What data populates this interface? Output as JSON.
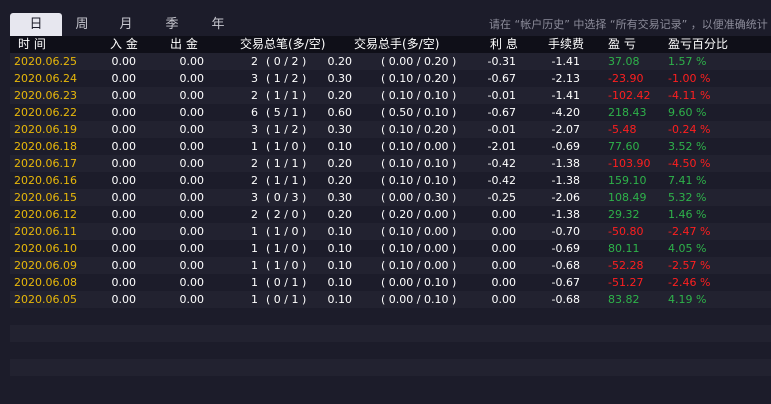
{
  "tabs": [
    {
      "label": "日",
      "active": true
    },
    {
      "label": "周",
      "active": false
    },
    {
      "label": "月",
      "active": false
    },
    {
      "label": "季",
      "active": false
    },
    {
      "label": "年",
      "active": false
    }
  ],
  "tip": "请在 “帐户历史” 中选择 “所有交易记录” ，以便准确统计",
  "columns": {
    "date": "时 间",
    "deposit": "入 金",
    "withdraw": "出 金",
    "trades": "交易总笔(多/空)",
    "lots": "交易总手(多/空)",
    "interest": "利 息",
    "fee": "手续费",
    "pnl": "盈 亏",
    "pnl_pct": "盈亏百分比"
  },
  "rows": [
    {
      "date": "2020.06.25",
      "deposit": "0.00",
      "withdraw": "0.00",
      "trades": "2",
      "trades_ls": "( 0 / 2 )",
      "lots": "0.20",
      "lots_ls": "( 0.00 / 0.20 )",
      "interest": "-0.31",
      "fee": "-1.41",
      "pnl": "37.08",
      "pnl_pct": "1.57 %",
      "sign": "pos"
    },
    {
      "date": "2020.06.24",
      "deposit": "0.00",
      "withdraw": "0.00",
      "trades": "3",
      "trades_ls": "( 1 / 2 )",
      "lots": "0.30",
      "lots_ls": "( 0.10 / 0.20 )",
      "interest": "-0.67",
      "fee": "-2.13",
      "pnl": "-23.90",
      "pnl_pct": "-1.00 %",
      "sign": "neg"
    },
    {
      "date": "2020.06.23",
      "deposit": "0.00",
      "withdraw": "0.00",
      "trades": "2",
      "trades_ls": "( 1 / 1 )",
      "lots": "0.20",
      "lots_ls": "( 0.10 / 0.10 )",
      "interest": "-0.01",
      "fee": "-1.41",
      "pnl": "-102.42",
      "pnl_pct": "-4.11 %",
      "sign": "neg"
    },
    {
      "date": "2020.06.22",
      "deposit": "0.00",
      "withdraw": "0.00",
      "trades": "6",
      "trades_ls": "( 5 / 1 )",
      "lots": "0.60",
      "lots_ls": "( 0.50 / 0.10 )",
      "interest": "-0.67",
      "fee": "-4.20",
      "pnl": "218.43",
      "pnl_pct": "9.60 %",
      "sign": "pos"
    },
    {
      "date": "2020.06.19",
      "deposit": "0.00",
      "withdraw": "0.00",
      "trades": "3",
      "trades_ls": "( 1 / 2 )",
      "lots": "0.30",
      "lots_ls": "( 0.10 / 0.20 )",
      "interest": "-0.01",
      "fee": "-2.07",
      "pnl": "-5.48",
      "pnl_pct": "-0.24 %",
      "sign": "neg"
    },
    {
      "date": "2020.06.18",
      "deposit": "0.00",
      "withdraw": "0.00",
      "trades": "1",
      "trades_ls": "( 1 / 0 )",
      "lots": "0.10",
      "lots_ls": "( 0.10 / 0.00 )",
      "interest": "-2.01",
      "fee": "-0.69",
      "pnl": "77.60",
      "pnl_pct": "3.52 %",
      "sign": "pos"
    },
    {
      "date": "2020.06.17",
      "deposit": "0.00",
      "withdraw": "0.00",
      "trades": "2",
      "trades_ls": "( 1 / 1 )",
      "lots": "0.20",
      "lots_ls": "( 0.10 / 0.10 )",
      "interest": "-0.42",
      "fee": "-1.38",
      "pnl": "-103.90",
      "pnl_pct": "-4.50 %",
      "sign": "neg"
    },
    {
      "date": "2020.06.16",
      "deposit": "0.00",
      "withdraw": "0.00",
      "trades": "2",
      "trades_ls": "( 1 / 1 )",
      "lots": "0.20",
      "lots_ls": "( 0.10 / 0.10 )",
      "interest": "-0.42",
      "fee": "-1.38",
      "pnl": "159.10",
      "pnl_pct": "7.41 %",
      "sign": "pos"
    },
    {
      "date": "2020.06.15",
      "deposit": "0.00",
      "withdraw": "0.00",
      "trades": "3",
      "trades_ls": "( 0 / 3 )",
      "lots": "0.30",
      "lots_ls": "( 0.00 / 0.30 )",
      "interest": "-0.25",
      "fee": "-2.06",
      "pnl": "108.49",
      "pnl_pct": "5.32 %",
      "sign": "pos"
    },
    {
      "date": "2020.06.12",
      "deposit": "0.00",
      "withdraw": "0.00",
      "trades": "2",
      "trades_ls": "( 2 / 0 )",
      "lots": "0.20",
      "lots_ls": "( 0.20 / 0.00 )",
      "interest": "0.00",
      "fee": "-1.38",
      "pnl": "29.32",
      "pnl_pct": "1.46 %",
      "sign": "pos"
    },
    {
      "date": "2020.06.11",
      "deposit": "0.00",
      "withdraw": "0.00",
      "trades": "1",
      "trades_ls": "( 1 / 0 )",
      "lots": "0.10",
      "lots_ls": "( 0.10 / 0.00 )",
      "interest": "0.00",
      "fee": "-0.70",
      "pnl": "-50.80",
      "pnl_pct": "-2.47 %",
      "sign": "neg"
    },
    {
      "date": "2020.06.10",
      "deposit": "0.00",
      "withdraw": "0.00",
      "trades": "1",
      "trades_ls": "( 1 / 0 )",
      "lots": "0.10",
      "lots_ls": "( 0.10 / 0.00 )",
      "interest": "0.00",
      "fee": "-0.69",
      "pnl": "80.11",
      "pnl_pct": "4.05 %",
      "sign": "pos"
    },
    {
      "date": "2020.06.09",
      "deposit": "0.00",
      "withdraw": "0.00",
      "trades": "1",
      "trades_ls": "( 1 / 0 )",
      "lots": "0.10",
      "lots_ls": "( 0.10 / 0.00 )",
      "interest": "0.00",
      "fee": "-0.68",
      "pnl": "-52.28",
      "pnl_pct": "-2.57 %",
      "sign": "neg"
    },
    {
      "date": "2020.06.08",
      "deposit": "0.00",
      "withdraw": "0.00",
      "trades": "1",
      "trades_ls": "( 0 / 1 )",
      "lots": "0.10",
      "lots_ls": "( 0.00 / 0.10 )",
      "interest": "0.00",
      "fee": "-0.67",
      "pnl": "-51.27",
      "pnl_pct": "-2.46 %",
      "sign": "neg"
    },
    {
      "date": "2020.06.05",
      "deposit": "0.00",
      "withdraw": "0.00",
      "trades": "1",
      "trades_ls": "( 0 / 1 )",
      "lots": "0.10",
      "lots_ls": "( 0.00 / 0.10 )",
      "interest": "0.00",
      "fee": "-0.68",
      "pnl": "83.82",
      "pnl_pct": "4.19 %",
      "sign": "pos"
    }
  ],
  "colors": {
    "date": "#e8b80a",
    "positive": "#2eb24a",
    "negative": "#ff1f1f",
    "background": "#1c1c2a",
    "header_background": "#0f0f18"
  }
}
